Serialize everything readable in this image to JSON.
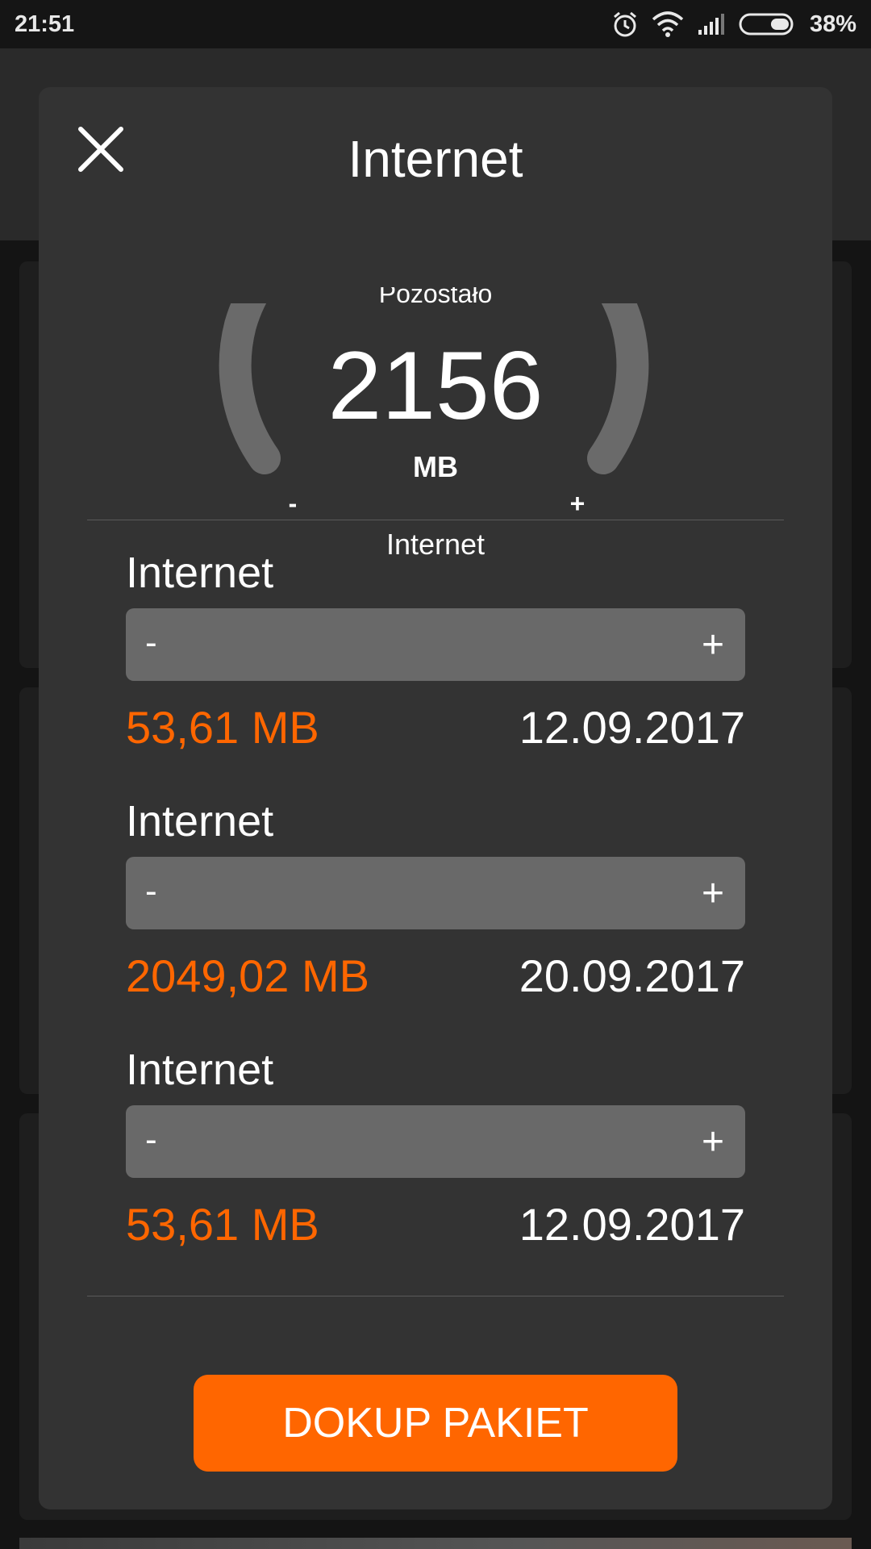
{
  "status_bar": {
    "time": "21:51",
    "battery_percent": "38%",
    "battery_level": 0.38,
    "icons": [
      "alarm-icon",
      "wifi-icon",
      "signal-icon",
      "battery-icon"
    ]
  },
  "modal": {
    "title": "Internet",
    "close_icon": "close-icon",
    "gauge": {
      "label": "Pozostało",
      "value": "2156",
      "unit": "MB",
      "minus": "-",
      "plus": "+",
      "name": "Internet"
    },
    "packages": [
      {
        "name": "Internet",
        "minus": "-",
        "plus": "+",
        "amount": "53,61 MB",
        "date": "12.09.2017"
      },
      {
        "name": "Internet",
        "minus": "-",
        "plus": "+",
        "amount": "2049,02 MB",
        "date": "20.09.2017"
      },
      {
        "name": "Internet",
        "minus": "-",
        "plus": "+",
        "amount": "53,61 MB",
        "date": "12.09.2017"
      }
    ],
    "buy_button": "DOKUP PAKIET"
  },
  "colors": {
    "accent": "#ff6600",
    "modal_bg": "#333333",
    "bar_bg": "#696969"
  }
}
